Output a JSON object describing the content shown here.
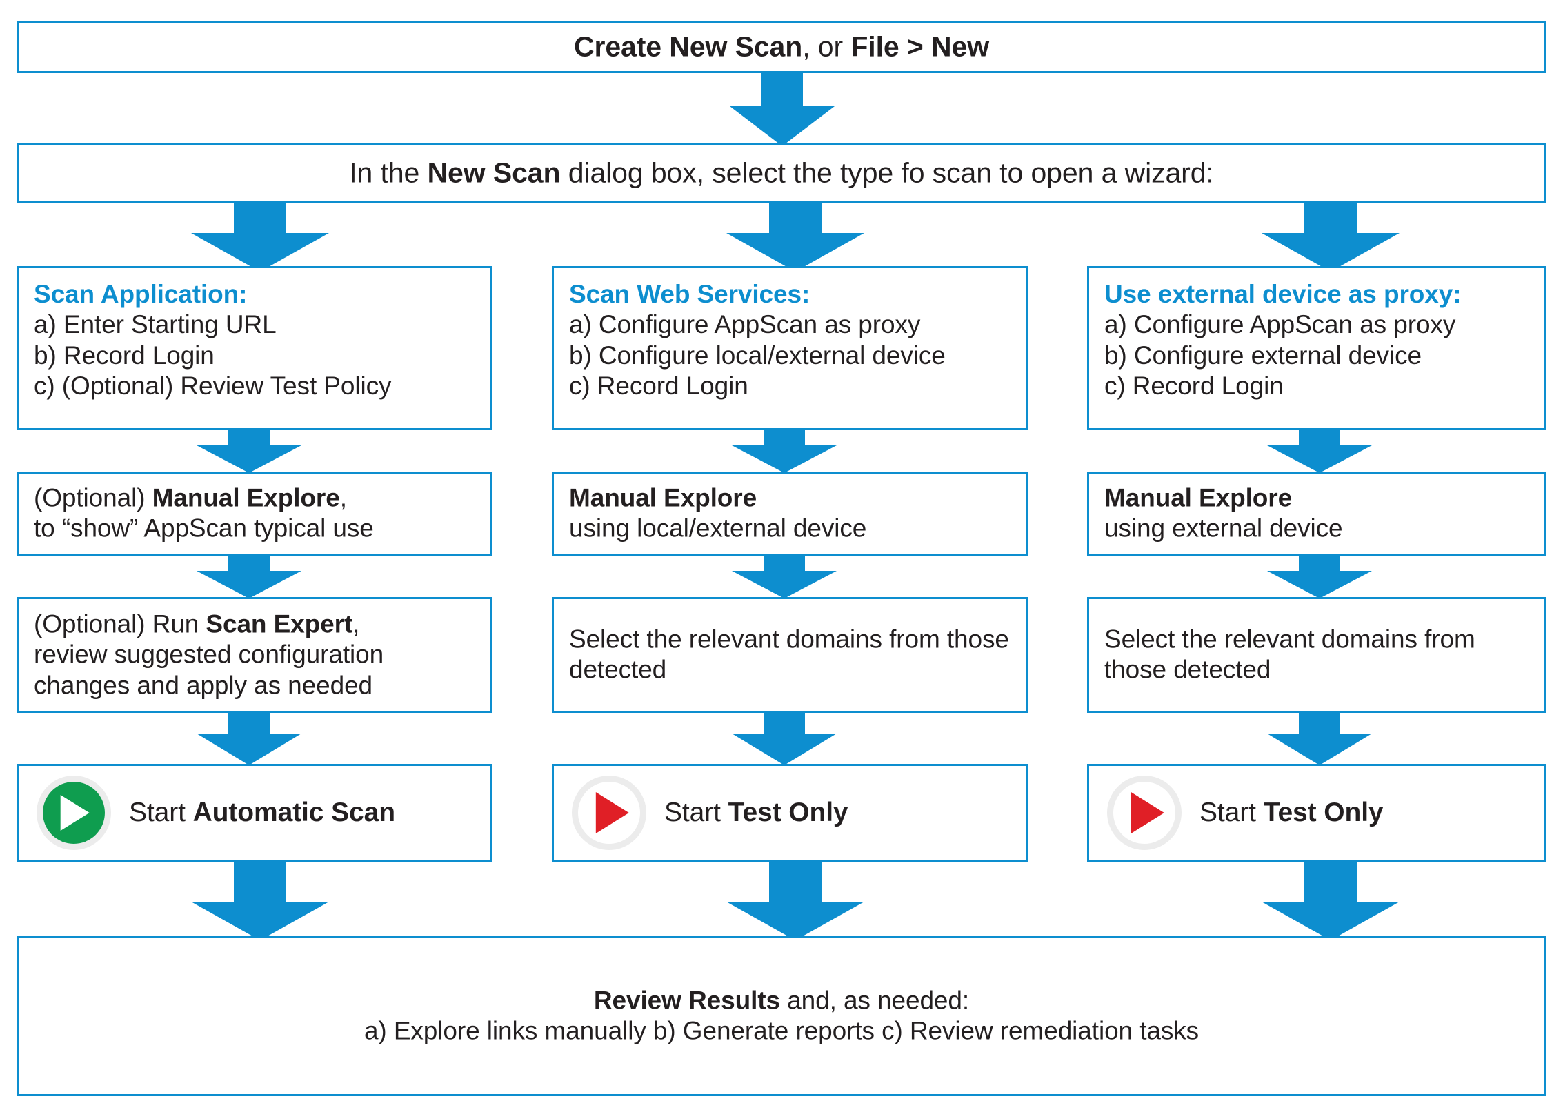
{
  "diagram": {
    "title": "AppScan Scan Workflow Flowchart",
    "colors": {
      "accent_blue": "#0d8ecf",
      "text_dark": "#231f20",
      "play_green": "#0f9d4f",
      "play_red": "#e01f26",
      "ring_gray": "#ececec"
    }
  },
  "top_banner": {
    "bold_1": "Create New Scan",
    "plain_1": ", or ",
    "bold_2": "File > New"
  },
  "second_banner": {
    "plain_1": "In the ",
    "bold_1": "New Scan",
    "plain_2": " dialog box, select the type fo scan to open a wizard:"
  },
  "columns": [
    {
      "id": "scan-application",
      "option": {
        "heading": "Scan Application:",
        "steps": [
          "a) Enter Starting URL",
          "b) Record Login",
          "c) (Optional) Review Test Policy"
        ]
      },
      "explore": {
        "lead_plain": "(Optional) ",
        "lead_bold": "Manual Explore",
        "lead_tail": ",",
        "second_line": "to “show” AppScan typical use"
      },
      "extra": {
        "lead_plain": "(Optional) Run ",
        "lead_bold": "Scan Expert",
        "lead_tail": ",",
        "lines": [
          "review suggested configuration",
          "changes and apply as needed"
        ]
      },
      "start": {
        "icon": "play-circle-green-icon",
        "plain": "Start ",
        "bold": "Automatic Scan"
      }
    },
    {
      "id": "scan-web-services",
      "option": {
        "heading": "Scan Web Services:",
        "steps": [
          "a) Configure AppScan as proxy",
          "b) Configure local/external device",
          "c) Record Login"
        ]
      },
      "explore": {
        "lead_plain": "",
        "lead_bold": "Manual Explore",
        "lead_tail": "",
        "second_line": "using local/external device"
      },
      "extra": {
        "lead_plain": "",
        "lead_bold": "",
        "lead_tail": "",
        "lines": [
          "Select the relevant domains",
          "from those detected"
        ]
      },
      "start": {
        "icon": "play-circle-red-icon",
        "plain": "Start ",
        "bold": "Test Only"
      }
    },
    {
      "id": "external-device-proxy",
      "option": {
        "heading": "Use external device as proxy:",
        "steps": [
          "a) Configure AppScan as proxy",
          "b) Configure external device",
          "c) Record Login"
        ]
      },
      "explore": {
        "lead_plain": "",
        "lead_bold": "Manual Explore",
        "lead_tail": "",
        "second_line": "using external device"
      },
      "extra": {
        "lead_plain": "",
        "lead_bold": "",
        "lead_tail": "",
        "lines": [
          "Select the relevant domains",
          "from those detected"
        ]
      },
      "start": {
        "icon": "play-circle-red-icon",
        "plain": "Start ",
        "bold": "Test Only"
      }
    }
  ],
  "bottom_banner": {
    "bold_1": "Review Results",
    "plain_1": " and, as needed:",
    "steps": [
      "a) Explore links manually",
      "b) Generate reports",
      "c) Review remediation tasks"
    ]
  }
}
